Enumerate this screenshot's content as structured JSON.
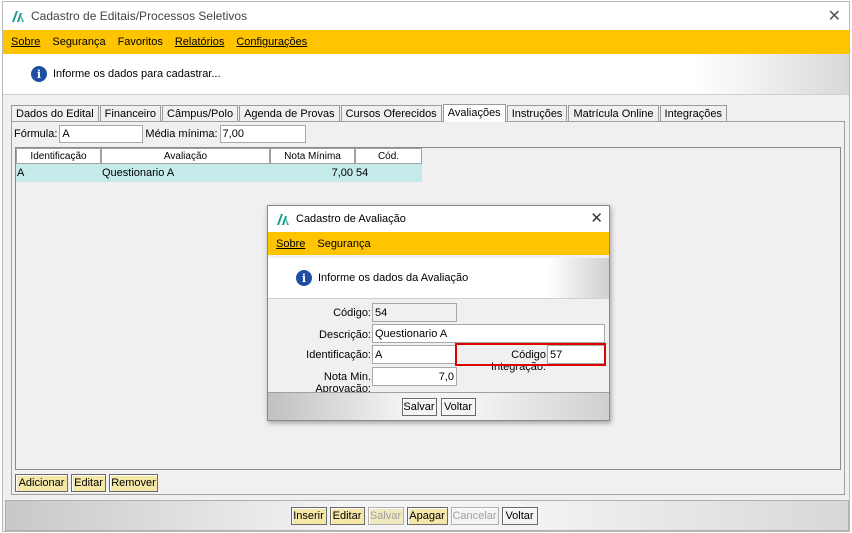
{
  "window": {
    "title": "Cadastro de Editais/Processos Seletivos"
  },
  "menu": [
    "Sobre",
    "Segurança",
    "Favoritos",
    "Relatórios",
    "Configurações"
  ],
  "info_message": "Informe os dados para cadastrar...",
  "tabs": [
    "Dados do Edital",
    "Financeiro",
    "Câmpus/Polo",
    "Agenda de Provas",
    "Cursos Oferecidos",
    "Avaliações",
    "Instruções",
    "Matrícula Online",
    "Integrações"
  ],
  "active_tab": "Avaliações",
  "formula": {
    "label": "Fórmula:",
    "value": "A",
    "media_label": "Média mínima:",
    "media_value": "7,00"
  },
  "grid": {
    "headers": [
      "Identificação",
      "Avaliação",
      "Nota Mínima",
      "Cód."
    ],
    "rows": [
      {
        "id": "A",
        "avaliacao": "Questionario A",
        "nota": "7,00",
        "cod": "54"
      }
    ]
  },
  "grid_buttons": [
    "Adicionar",
    "Editar",
    "Remover"
  ],
  "footer_buttons": [
    "Inserir",
    "Editar",
    "Salvar",
    "Apagar",
    "Cancelar",
    "Voltar"
  ],
  "dialog": {
    "title": "Cadastro de Avaliação",
    "menu": [
      "Sobre",
      "Segurança"
    ],
    "info": "Informe os dados da Avaliação",
    "codigo_label": "Código:",
    "codigo": "54",
    "descricao_label": "Descrição:",
    "descricao": "Questionario A",
    "identificacao_label": "Identificação:",
    "identificacao": "A",
    "cod_integracao_label": "Código Integração:",
    "cod_integracao": "57",
    "nota_label": "Nota Min. Aprovação:",
    "nota": "7,0",
    "buttons": [
      "Salvar",
      "Voltar"
    ]
  },
  "colors": {
    "menu_yellow": "#ffc400",
    "row_highlight": "#c5eaea",
    "button_yellow": "#f5e7a8",
    "highlight_red": "#e00000"
  }
}
